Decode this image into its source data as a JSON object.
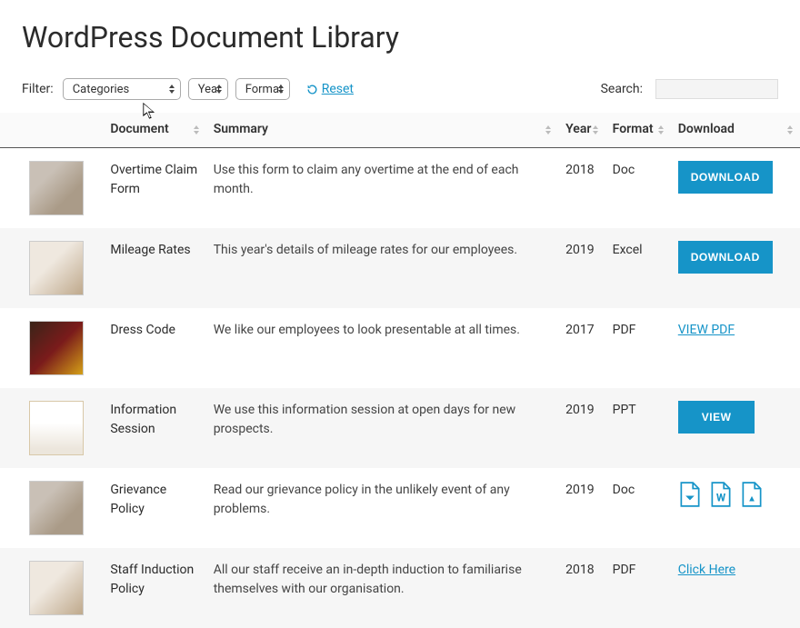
{
  "page": {
    "title": "WordPress Document Library"
  },
  "filters": {
    "label": "Filter:",
    "categories": "Categories",
    "year": "Year",
    "format": "Format",
    "reset": "Reset"
  },
  "search": {
    "label": "Search:",
    "value": ""
  },
  "table": {
    "headers": {
      "document": "Document",
      "summary": "Summary",
      "year": "Year",
      "format": "Format",
      "download": "Download"
    },
    "rows": [
      {
        "document": "Overtime Claim Form",
        "summary": "Use this form to claim any overtime at the end of each month.",
        "year": "2018",
        "format": "Doc",
        "download_type": "button",
        "download_label": "DOWNLOAD"
      },
      {
        "document": "Mileage Rates",
        "summary": "This year's details of mileage rates for our employees.",
        "year": "2019",
        "format": "Excel",
        "download_type": "button",
        "download_label": "DOWNLOAD"
      },
      {
        "document": "Dress Code",
        "summary": "We like our employees to look presentable at all times.",
        "year": "2017",
        "format": "PDF",
        "download_type": "link",
        "download_label": "VIEW PDF"
      },
      {
        "document": "Information Session",
        "summary": "We use this information session at open days for new prospects.",
        "year": "2019",
        "format": "PPT",
        "download_type": "button_small",
        "download_label": "VIEW"
      },
      {
        "document": "Grievance Policy",
        "summary": "Read our grievance policy in the unlikely event of any problems.",
        "year": "2019",
        "format": "Doc",
        "download_type": "icons",
        "download_label": ""
      },
      {
        "document": "Staff Induction Policy",
        "summary": "All our staff receive an in-depth induction to familiarise themselves with our organisation.",
        "year": "2018",
        "format": "PDF",
        "download_type": "link",
        "download_label": "Click Here"
      }
    ]
  }
}
